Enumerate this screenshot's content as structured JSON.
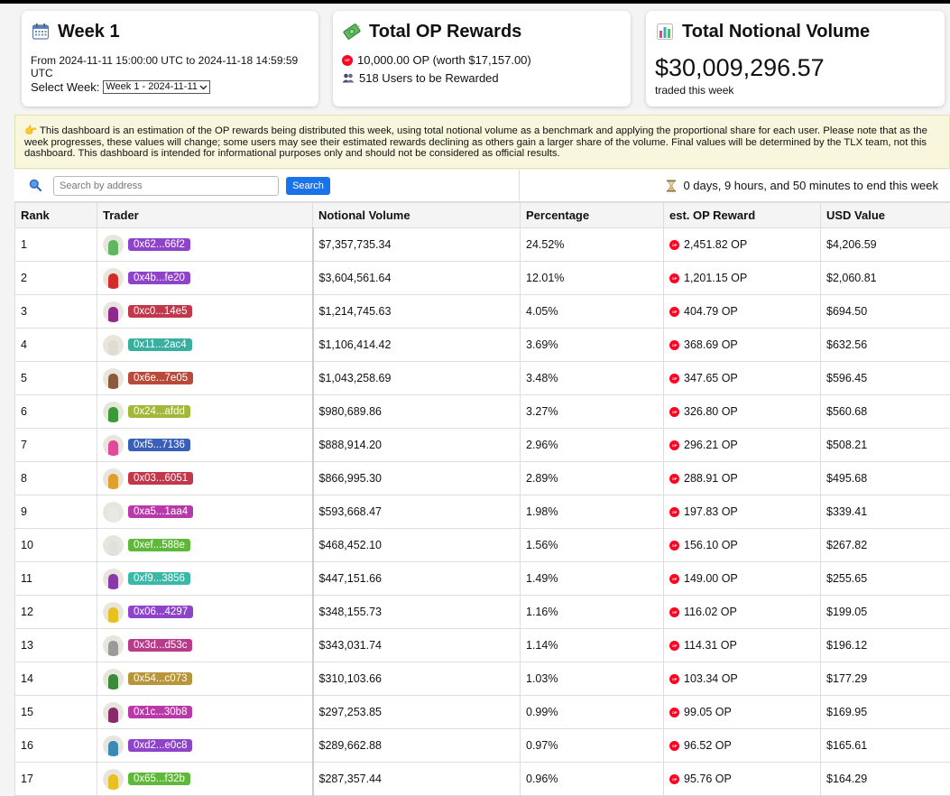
{
  "week_card": {
    "icon": "calendar-icon",
    "title": "Week 1",
    "range": "From 2024-11-11 15:00:00 UTC to 2024-11-18 14:59:59 UTC",
    "select_label": "Select Week:",
    "selected_week": "Week 1 - 2024-11-11"
  },
  "rewards_card": {
    "icon": "money-icon",
    "title": "Total OP Rewards",
    "op_amount": "10,000.00 OP (worth $17,157.00)",
    "users": "518 Users to be Rewarded"
  },
  "volume_card": {
    "icon": "bar-chart-icon",
    "title": "Total Notional Volume",
    "value": "$30,009,296.57",
    "sub": "traded this week"
  },
  "notice": "This dashboard is an estimation of the OP rewards being distributed this week, using total notional volume as a benchmark and applying the proportional share for each user. Please note that as the week progresses, these values will change; some users may see their estimated rewards declining as others gain a larger share of the volume. Final values will be determined by the TLX team, not this dashboard. This dashboard is intended for informational purposes only and should not be considered as official results.",
  "search": {
    "placeholder": "Search by address",
    "button": "Search"
  },
  "countdown": "0 days, 9 hours, and 50 minutes to end this week",
  "colors": {
    "op_red": "#ff0420",
    "accent_blue": "#1a73e8"
  },
  "table": {
    "headers": [
      "Rank",
      "Trader",
      "Notional Volume",
      "Percentage",
      "est. OP Reward",
      "USD Value"
    ],
    "rows": [
      {
        "rank": "1",
        "addr": "0x62...66f2",
        "color": "#8e44c9",
        "avatar": "#5fb85f",
        "volume": "$7,357,735.34",
        "pct": "24.52%",
        "reward": "2,451.82 OP",
        "usd": "$4,206.59"
      },
      {
        "rank": "2",
        "addr": "0x4b...fe20",
        "color": "#8e44c9",
        "avatar": "#d42a2a",
        "volume": "$3,604,561.64",
        "pct": "12.01%",
        "reward": "1,201.15 OP",
        "usd": "$2,060.81"
      },
      {
        "rank": "3",
        "addr": "0xc0...14e5",
        "color": "#c0384a",
        "avatar": "#8e2a8e",
        "volume": "$1,214,745.63",
        "pct": "4.05%",
        "reward": "404.79 OP",
        "usd": "$694.50"
      },
      {
        "rank": "4",
        "addr": "0x11...2ac4",
        "color": "#3aaf9f",
        "avatar": "#e0dcd0",
        "volume": "$1,106,414.42",
        "pct": "3.69%",
        "reward": "368.69 OP",
        "usd": "$632.56"
      },
      {
        "rank": "5",
        "addr": "0x6e...7e05",
        "color": "#b84a3a",
        "avatar": "#8a5a3a",
        "volume": "$1,043,258.69",
        "pct": "3.48%",
        "reward": "347.65 OP",
        "usd": "$596.45"
      },
      {
        "rank": "6",
        "addr": "0x24...afdd",
        "color": "#a3b83a",
        "avatar": "#3a9a3a",
        "volume": "$980,689.86",
        "pct": "3.27%",
        "reward": "326.80 OP",
        "usd": "$560.68"
      },
      {
        "rank": "7",
        "addr": "0xf5...7136",
        "color": "#3a5fb8",
        "avatar": "#e04a9a",
        "volume": "$888,914.20",
        "pct": "2.96%",
        "reward": "296.21 OP",
        "usd": "$508.21"
      },
      {
        "rank": "8",
        "addr": "0x03...6051",
        "color": "#c0384a",
        "avatar": "#e0a030",
        "volume": "$866,995.30",
        "pct": "2.89%",
        "reward": "288.91 OP",
        "usd": "$495.68"
      },
      {
        "rank": "9",
        "addr": "0xa5...1aa4",
        "color": "#b83aa8",
        "avatar": "#e8e8e8",
        "volume": "$593,668.47",
        "pct": "1.98%",
        "reward": "197.83 OP",
        "usd": "$339.41"
      },
      {
        "rank": "10",
        "addr": "0xef...588e",
        "color": "#5fb83a",
        "avatar": "#e0e0e0",
        "volume": "$468,452.10",
        "pct": "1.56%",
        "reward": "156.10 OP",
        "usd": "$267.82"
      },
      {
        "rank": "11",
        "addr": "0xf9...3856",
        "color": "#3ab8a8",
        "avatar": "#8a3aa8",
        "volume": "$447,151.66",
        "pct": "1.49%",
        "reward": "149.00 OP",
        "usd": "$255.65"
      },
      {
        "rank": "12",
        "addr": "0x06...4297",
        "color": "#8e44c9",
        "avatar": "#e8c020",
        "volume": "$348,155.73",
        "pct": "1.16%",
        "reward": "116.02 OP",
        "usd": "$199.05"
      },
      {
        "rank": "13",
        "addr": "0x3d...d53c",
        "color": "#b83a8a",
        "avatar": "#9a9a9a",
        "volume": "$343,031.74",
        "pct": "1.14%",
        "reward": "114.31 OP",
        "usd": "$196.12"
      },
      {
        "rank": "14",
        "addr": "0x54...c073",
        "color": "#b8943a",
        "avatar": "#3a8a3a",
        "volume": "$310,103.66",
        "pct": "1.03%",
        "reward": "103.34 OP",
        "usd": "$177.29"
      },
      {
        "rank": "15",
        "addr": "0x1c...30b8",
        "color": "#b83aa8",
        "avatar": "#8a2a6a",
        "volume": "$297,253.85",
        "pct": "0.99%",
        "reward": "99.05 OP",
        "usd": "$169.95"
      },
      {
        "rank": "16",
        "addr": "0xd2...e0c8",
        "color": "#8e44c9",
        "avatar": "#3a8ab8",
        "volume": "$289,662.88",
        "pct": "0.97%",
        "reward": "96.52 OP",
        "usd": "$165.61"
      },
      {
        "rank": "17",
        "addr": "0x65...f32b",
        "color": "#5fb83a",
        "avatar": "#e8c020",
        "volume": "$287,357.44",
        "pct": "0.96%",
        "reward": "95.76 OP",
        "usd": "$164.29"
      }
    ]
  }
}
